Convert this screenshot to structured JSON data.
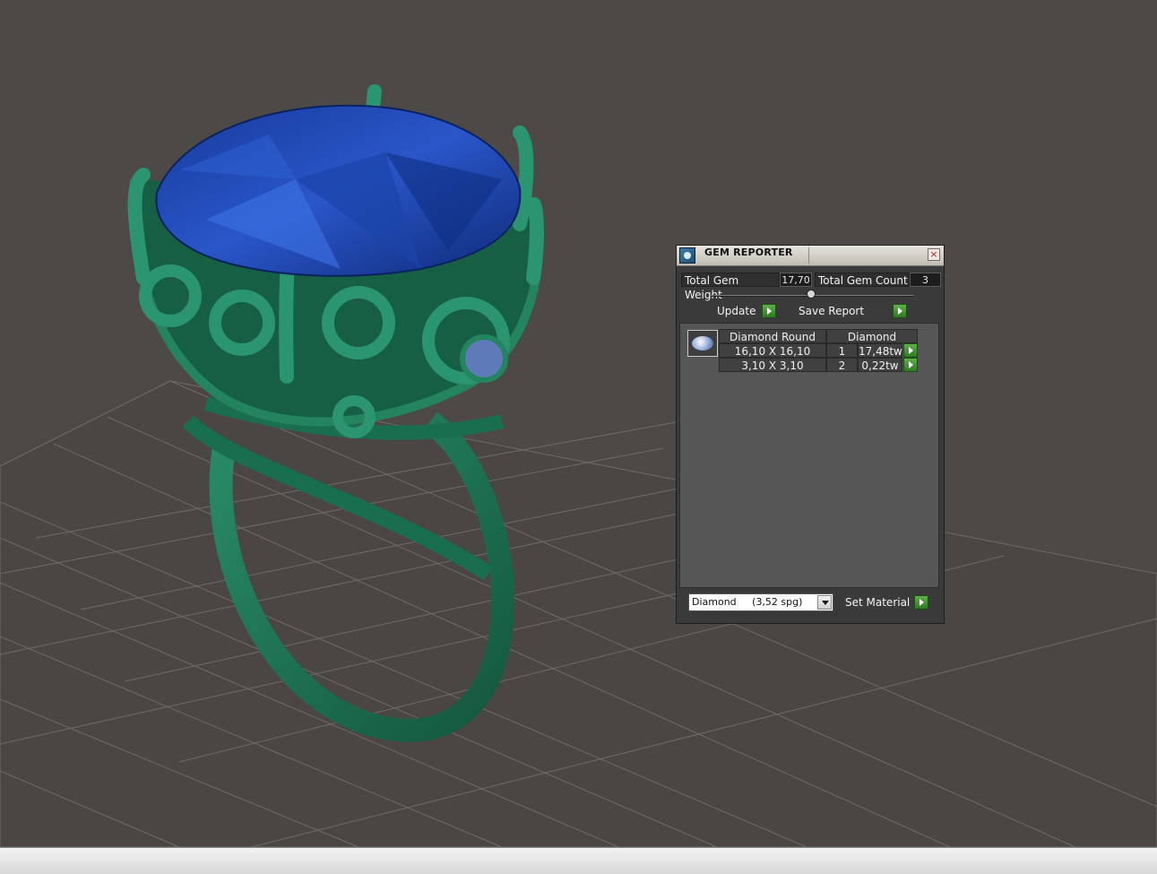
{
  "panel": {
    "title": "GEM REPORTER",
    "close_symbol": "×",
    "total_weight_label": "Total Gem Weight",
    "total_weight_value": "17,70",
    "total_count_label": "Total Gem Count",
    "total_count_value": "3",
    "update_label": "Update",
    "save_report_label": "Save Report",
    "table": {
      "group_header": "Diamond Round",
      "material_header": "Diamond",
      "rows": [
        {
          "size": "16,10 X 16,10",
          "count": "1",
          "weight": "17,48tw"
        },
        {
          "size": "3,10 X 3,10",
          "count": "2",
          "weight": "0,22tw"
        }
      ]
    },
    "material_select_value": "Diamond     (3,52 spg)",
    "set_material_label": "Set Material"
  },
  "colors": {
    "background": "#4d4947",
    "grid": "#6e6b69",
    "ring_metal": "#1f7a5a",
    "gem": "#2a56c9",
    "accent_green": "#3b9a2c"
  }
}
